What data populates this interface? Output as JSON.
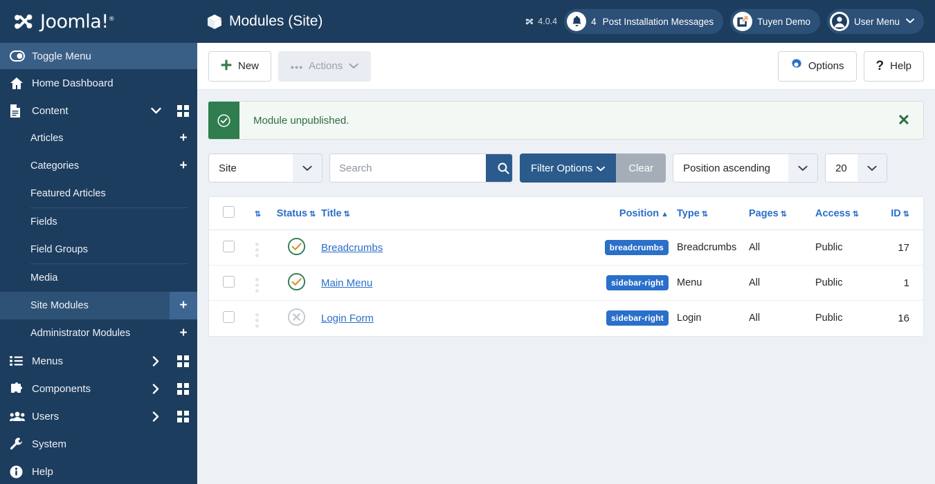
{
  "brand": {
    "name": "Joomla!",
    "registered": "®"
  },
  "sidebar": {
    "toggle": {
      "label": "Toggle Menu",
      "icon": "toggle-icon"
    },
    "items": [
      {
        "label": "Home Dashboard",
        "icon": "home-icon",
        "level": 1,
        "caret": "",
        "grid": false,
        "plus": false,
        "active": false
      },
      {
        "label": "Content",
        "icon": "document-icon",
        "level": 1,
        "caret": "▼",
        "grid": true,
        "plus": false,
        "active": false
      },
      {
        "label": "Articles",
        "icon": "",
        "level": 2,
        "caret": "",
        "grid": false,
        "plus": true,
        "active": false,
        "sep_after": false
      },
      {
        "label": "Categories",
        "icon": "",
        "level": 2,
        "caret": "",
        "grid": false,
        "plus": true,
        "active": false,
        "sep_after": false
      },
      {
        "label": "Featured Articles",
        "icon": "",
        "level": 2,
        "caret": "",
        "grid": false,
        "plus": false,
        "active": false,
        "sep_after": true
      },
      {
        "label": "Fields",
        "icon": "",
        "level": 2,
        "caret": "",
        "grid": false,
        "plus": false,
        "active": false,
        "sep_after": false
      },
      {
        "label": "Field Groups",
        "icon": "",
        "level": 2,
        "caret": "",
        "grid": false,
        "plus": false,
        "active": false,
        "sep_after": true
      },
      {
        "label": "Media",
        "icon": "",
        "level": 2,
        "caret": "",
        "grid": false,
        "plus": false,
        "active": false,
        "sep_after": false
      },
      {
        "label": "Site Modules",
        "icon": "",
        "level": 2,
        "caret": "",
        "grid": false,
        "plus": true,
        "active": true,
        "sep_after": false
      },
      {
        "label": "Administrator Modules",
        "icon": "",
        "level": 2,
        "caret": "",
        "grid": false,
        "plus": true,
        "active": false,
        "sep_after": false
      },
      {
        "label": "Menus",
        "icon": "list-icon",
        "level": 1,
        "caret": "›",
        "grid": true,
        "plus": false,
        "active": false
      },
      {
        "label": "Components",
        "icon": "puzzle-icon",
        "level": 1,
        "caret": "›",
        "grid": true,
        "plus": false,
        "active": false
      },
      {
        "label": "Users",
        "icon": "users-icon",
        "level": 1,
        "caret": "›",
        "grid": true,
        "plus": false,
        "active": false
      },
      {
        "label": "System",
        "icon": "wrench-icon",
        "level": 1,
        "caret": "",
        "grid": false,
        "plus": false,
        "active": false
      },
      {
        "label": "Help",
        "icon": "info-icon",
        "level": 1,
        "caret": "",
        "grid": false,
        "plus": false,
        "active": false
      }
    ]
  },
  "header": {
    "title": "Modules (Site)",
    "title_icon": "cube-icon",
    "version": "4.0.4",
    "messages": {
      "count": "4",
      "label": "Post Installation Messages",
      "icon": "bell-icon"
    },
    "site": {
      "label": "Tuyen Demo",
      "icon": "external-link-icon"
    },
    "user": {
      "label": "User Menu",
      "icon": "user-circle-icon",
      "chevron": "⌄"
    }
  },
  "toolbar": {
    "new_label": "New",
    "actions_label": "Actions",
    "options_label": "Options",
    "help_label": "Help"
  },
  "alert": {
    "message": "Module unpublished.",
    "icon": "check-circle-icon",
    "close": "✕"
  },
  "filters": {
    "scope": "Site",
    "search_placeholder": "Search",
    "search_value": "",
    "filter_options_label": "Filter Options",
    "clear_label": "Clear",
    "sort": "Position ascending",
    "limit": "20"
  },
  "table": {
    "columns": [
      {
        "key": "checkbox",
        "label": "",
        "sortable": false
      },
      {
        "key": "ordering",
        "label": "",
        "sortable": true,
        "sorter": "⇅"
      },
      {
        "key": "status",
        "label": "Status",
        "sortable": true,
        "sorter": "⇅"
      },
      {
        "key": "title",
        "label": "Title",
        "sortable": true,
        "sorter": "⇅"
      },
      {
        "key": "position",
        "label": "Position",
        "sortable": true,
        "sorter": "▲"
      },
      {
        "key": "type",
        "label": "Type",
        "sortable": true,
        "sorter": "⇅"
      },
      {
        "key": "pages",
        "label": "Pages",
        "sortable": true,
        "sorter": "⇅"
      },
      {
        "key": "access",
        "label": "Access",
        "sortable": true,
        "sorter": "⇅"
      },
      {
        "key": "id",
        "label": "ID",
        "sortable": true,
        "sorter": "⇅"
      }
    ],
    "rows": [
      {
        "status": "published",
        "title": "Breadcrumbs",
        "position": "breadcrumbs",
        "type": "Breadcrumbs",
        "pages": "All",
        "access": "Public",
        "id": "17"
      },
      {
        "status": "published",
        "title": "Main Menu",
        "position": "sidebar-right",
        "type": "Menu",
        "pages": "All",
        "access": "Public",
        "id": "1"
      },
      {
        "status": "unpublished",
        "title": "Login Form",
        "position": "sidebar-right",
        "type": "Login",
        "pages": "All",
        "access": "Public",
        "id": "16"
      }
    ]
  },
  "colors": {
    "sidebar_bg": "#1c3d5e",
    "accent_blue": "#2a6fc9",
    "button_blue": "#2a5b8c",
    "success_green": "#2f7d4f",
    "page_bg": "#edf1f6"
  }
}
